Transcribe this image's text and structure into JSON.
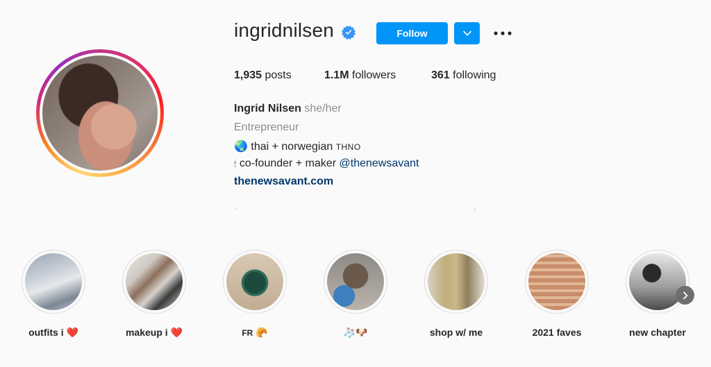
{
  "profile": {
    "username": "ingridnilsen",
    "follow_label": "Follow",
    "stats": {
      "posts_count": "1,935",
      "posts_label": "posts",
      "followers_count": "1.1M",
      "followers_label": "followers",
      "following_count": "361",
      "following_label": "following"
    },
    "bio": {
      "full_name": "Ingrid Nilsen",
      "pronouns": "she/her",
      "category": "Entrepreneur",
      "line1_emoji": "🌏",
      "line1_text": "thai + norwegian",
      "line1_caps": "THNO",
      "line2_emoji": "🕯",
      "line2_text": "co-founder + maker",
      "line2_mention": "@thenewsavant",
      "website": "thenewsavant.com"
    }
  },
  "highlights": [
    {
      "label": "outfits i",
      "emoji": "❤️"
    },
    {
      "label": "makeup i",
      "emoji": "❤️"
    },
    {
      "label": "FR",
      "emoji": "🥐"
    },
    {
      "label": "",
      "emoji": "🧦🐶"
    },
    {
      "label": "shop w/ me",
      "emoji": ""
    },
    {
      "label": "2021 faves",
      "emoji": ""
    },
    {
      "label": "new chapter",
      "emoji": ""
    }
  ],
  "icons": {
    "verified": "verified-badge-icon",
    "dropdown": "chevron-down-icon",
    "more": "more-options-icon",
    "next": "chevron-right-icon"
  },
  "colors": {
    "primary_button": "#0095f6",
    "link": "#00376b",
    "secondary_text": "#8e8e8e",
    "heart": "#e0245e"
  }
}
